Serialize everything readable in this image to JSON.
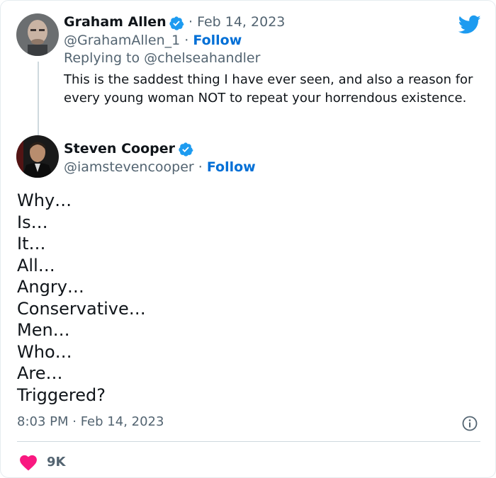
{
  "reply_tweet": {
    "author_name": "Graham Allen",
    "date": "· Feb 14, 2023",
    "handle": "@GrahamAllen_1",
    "separator": " · ",
    "follow_label": "Follow",
    "replying_to": "Replying to @chelseahandler",
    "text": "This is the saddest thing I have ever seen, and also a reason for every young woman NOT to repeat your horrendous existence."
  },
  "main_tweet": {
    "author_name": "Steven Cooper",
    "handle": "@iamstevencooper",
    "separator": " · ",
    "follow_label": "Follow",
    "lines": [
      "Why…",
      "Is…",
      "It…",
      "All…",
      "Angry…",
      "Conservative…",
      "Men…",
      "Who…",
      "Are…",
      "Triggered?"
    ],
    "timestamp": "8:03 PM · Feb 14, 2023",
    "likes": "9K"
  },
  "colors": {
    "link": "#006fd6",
    "verified": "#1d9bf0",
    "heart": "#f91880",
    "muted": "#536471",
    "twitter_blue": "#1d9bf0"
  },
  "icons": {
    "brand": "twitter-bird-icon",
    "verified": "verified-badge-icon",
    "info": "info-icon",
    "like": "heart-icon"
  }
}
